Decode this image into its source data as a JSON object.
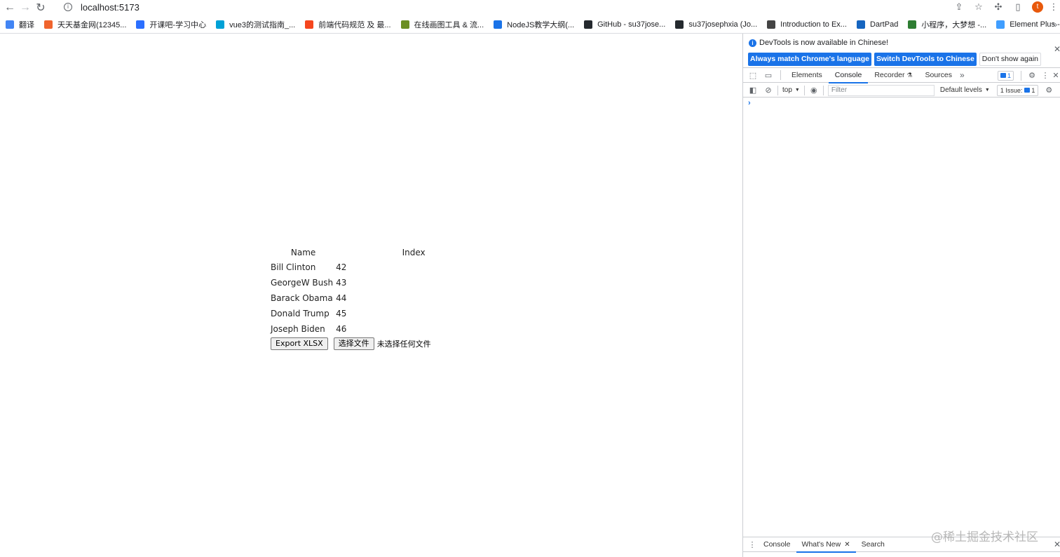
{
  "browser": {
    "url": "localhost:5173",
    "bookmarks": [
      {
        "label": "翻译",
        "icon": "translate-icon",
        "color": "#4285f4"
      },
      {
        "label": "天天基金网(12345...",
        "icon": "fund-icon",
        "color": "#f0642d"
      },
      {
        "label": "开课吧-学习中心",
        "icon": "kaikeba-icon",
        "color": "#2b6fff"
      },
      {
        "label": "vue3的测试指南_...",
        "icon": "bilibili-icon",
        "color": "#00a1d6"
      },
      {
        "label": "前端代码规范 及 最...",
        "icon": "red-square-icon",
        "color": "#f5461e"
      },
      {
        "label": "在线画图工具 & 流...",
        "icon": "diagram-icon",
        "color": "#6b8e23"
      },
      {
        "label": "NodeJS教学大纲(...",
        "icon": "onenote-icon",
        "color": "#1a73e8"
      },
      {
        "label": "GitHub - su37jose...",
        "icon": "github-icon",
        "color": "#24292e"
      },
      {
        "label": "su37josephxia (Jo...",
        "icon": "github-icon",
        "color": "#24292e"
      },
      {
        "label": "Introduction to Ex...",
        "icon": "express-icon",
        "color": "#444444"
      },
      {
        "label": "DartPad",
        "icon": "dart-icon",
        "color": "#1565c0"
      },
      {
        "label": "小程序，大梦想 -...",
        "icon": "miniprogram-icon",
        "color": "#2e7d32"
      },
      {
        "label": "Element Plus - Th...",
        "icon": "element-icon",
        "color": "#409eff"
      }
    ],
    "bookmarks_overflow": "»",
    "profile_initial": "t"
  },
  "app": {
    "headers": {
      "name": "Name",
      "index": "Index"
    },
    "rows": [
      {
        "name": "Bill Clinton",
        "index": "42"
      },
      {
        "name": "GeorgeW Bush",
        "index": "43"
      },
      {
        "name": "Barack Obama",
        "index": "44"
      },
      {
        "name": "Donald Trump",
        "index": "45"
      },
      {
        "name": "Joseph Biden",
        "index": "46"
      }
    ],
    "export_label": "Export XLSX",
    "file_button_label": "选择文件",
    "file_status": "未选择任何文件"
  },
  "devtools": {
    "info_message": "DevTools is now available in Chinese!",
    "match_language_label": "Always match Chrome's language",
    "switch_language_label": "Switch DevTools to Chinese",
    "dont_show_label": "Don't show again",
    "tabs": [
      "Elements",
      "Console",
      "Recorder",
      "Sources"
    ],
    "active_tab": "Console",
    "more_tabs": "»",
    "message_count": "1",
    "context": "top",
    "filter_placeholder": "Filter",
    "levels": "Default levels",
    "issues_label": "1 Issue:",
    "issues_count": "1",
    "prompt": "›",
    "drawer_tabs": [
      "Console",
      "What's New",
      "Search"
    ],
    "drawer_active": "What's New"
  },
  "watermark": "@稀土掘金技术社区",
  "colors": {
    "accent": "#1a73e8",
    "profile": "#e8590c"
  }
}
